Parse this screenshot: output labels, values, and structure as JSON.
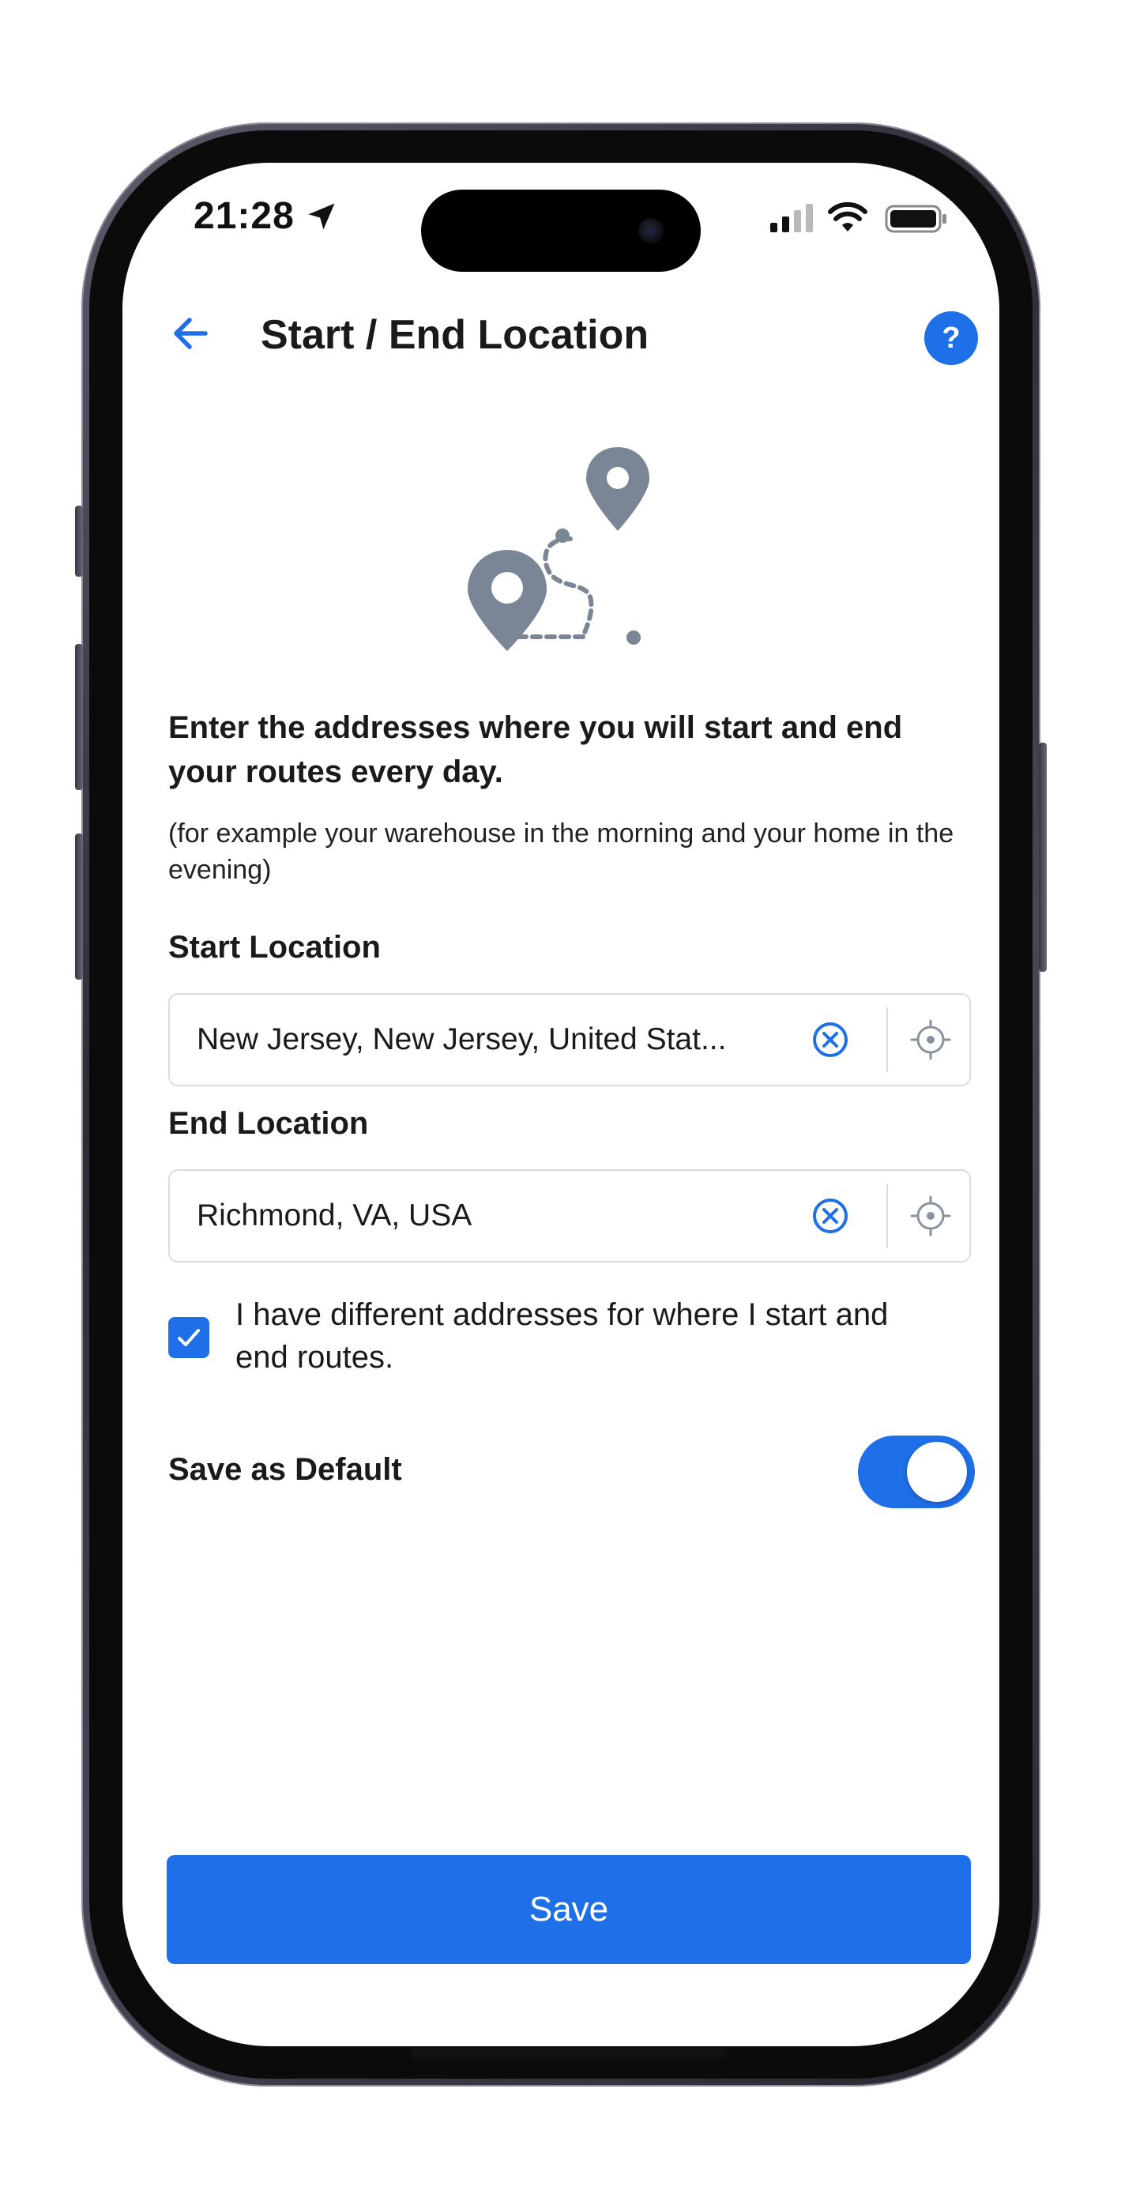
{
  "status_bar": {
    "time": "21:28",
    "location_icon": "location-arrow-icon",
    "signal_icon": "cellular-signal-icon",
    "wifi_icon": "wifi-icon",
    "battery_icon": "battery-icon"
  },
  "header": {
    "back_icon": "arrow-left-icon",
    "title": "Start / End Location",
    "help_label": "?"
  },
  "illustration": {
    "icon": "route-pins-icon"
  },
  "intro": {
    "heading": "Enter the addresses where you will start and end your routes every day.",
    "note": "(for example your warehouse in the morning and your home in the evening)"
  },
  "start_location": {
    "label": "Start Location",
    "value": "New Jersey, New Jersey, United Stat..."
  },
  "end_location": {
    "label": "End Location",
    "value": "Richmond, VA, USA"
  },
  "different_addresses": {
    "checked": true,
    "label": "I have different addresses for where I start and end routes."
  },
  "save_default": {
    "label": "Save as Default",
    "on": true
  },
  "save_button": {
    "label": "Save"
  },
  "colors": {
    "accent": "#1e6fe8",
    "illustration": "#7a8595",
    "border": "#d9dce1"
  }
}
